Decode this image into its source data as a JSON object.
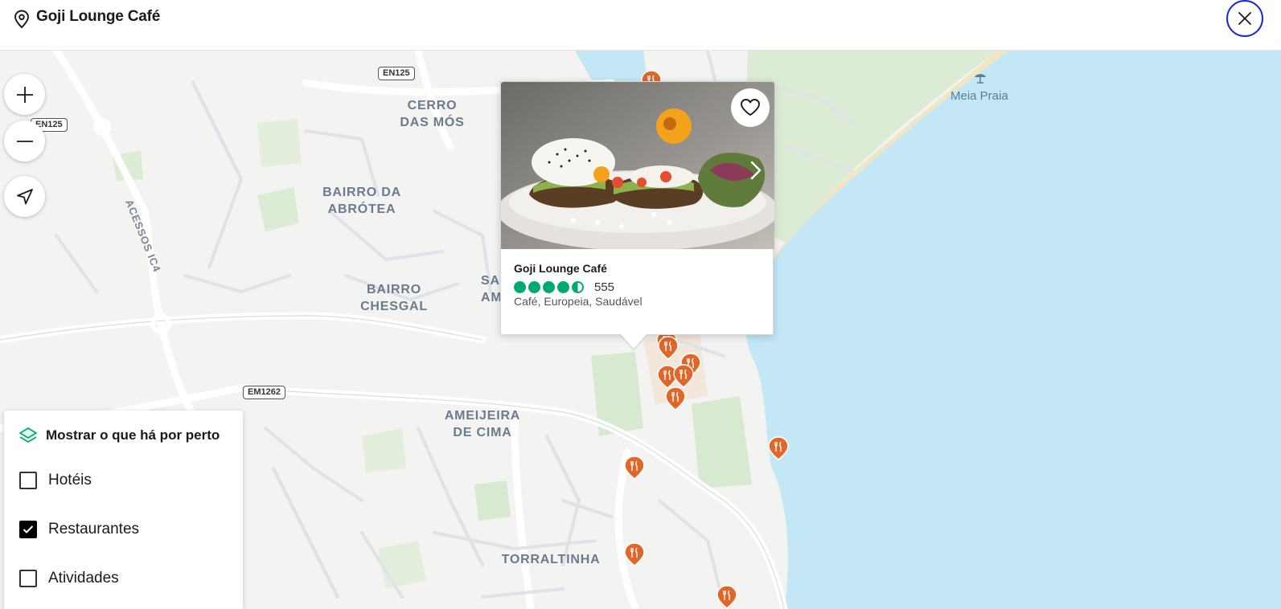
{
  "header": {
    "title": "Goji Lounge Café",
    "pin_icon": "map-pin-icon",
    "close_icon": "close-icon",
    "accent_color": "#1d27d6"
  },
  "map": {
    "place_labels": [
      {
        "key": "cerro",
        "text": "CERRO\nDAS MÓS"
      },
      {
        "key": "abrotea",
        "text": "BAIRRO DA\nABRÓTEA"
      },
      {
        "key": "chesgal",
        "text": "BAIRRO\nCHESGAL"
      },
      {
        "key": "sam",
        "text": "SA\nAM"
      },
      {
        "key": "ameijeira",
        "text": "AMEIJEIRA\nDE CIMA"
      },
      {
        "key": "torraltinha",
        "text": "TORRALTINHA"
      },
      {
        "key": "acessos",
        "text": "ACESSOS IC4"
      }
    ],
    "road_shields": [
      "EN125",
      "EN125",
      "EM1262"
    ],
    "beach_label": "Meia Praia",
    "water_color": "#c3e7f5",
    "marker_color": "#e0662a"
  },
  "controls": {
    "zoom_in_icon": "plus-icon",
    "zoom_out_icon": "minus-icon",
    "locate_icon": "navigation-arrow-icon"
  },
  "popup": {
    "name": "Goji Lounge Café",
    "rating": 4.5,
    "review_count": "555",
    "cuisine": "Café, Europeia, Saudável",
    "heart_icon": "heart-icon",
    "next_icon": "chevron-right-icon",
    "rating_color": "#00aa6c"
  },
  "nearby": {
    "title": "Mostrar o que há por perto",
    "layers_icon": "layers-icon",
    "options": [
      {
        "label": "Hotéis",
        "checked": false
      },
      {
        "label": "Restaurantes",
        "checked": true
      },
      {
        "label": "Atividades",
        "checked": false
      }
    ]
  }
}
